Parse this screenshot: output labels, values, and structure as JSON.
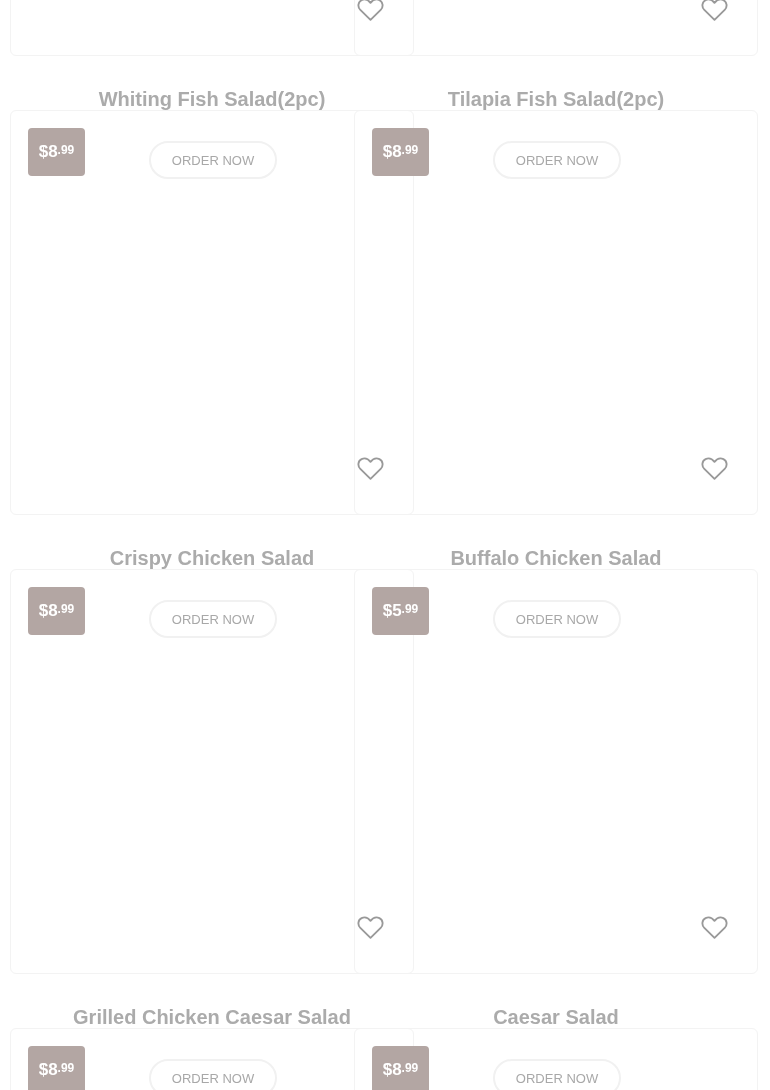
{
  "items": [
    {
      "kind": "card",
      "heart": true
    },
    {
      "kind": "card",
      "heart": true
    },
    {
      "kind": "card",
      "title": "Whiting Fish Salad(2pc)",
      "price_main": "$8",
      "price_cents": ".99",
      "button": "ORDER NOW",
      "heart": true
    },
    {
      "kind": "card",
      "title": "Tilapia Fish Salad(2pc)",
      "price_main": "$8",
      "price_cents": ".99",
      "button": "ORDER NOW",
      "heart": true
    },
    {
      "kind": "card",
      "title": "Crispy Chicken Salad",
      "price_main": "$8",
      "price_cents": ".99",
      "button": "ORDER NOW",
      "heart": true
    },
    {
      "kind": "card",
      "title": "Buffalo Chicken Salad",
      "price_main": "$5",
      "price_cents": ".99",
      "button": "ORDER NOW",
      "heart": true
    },
    {
      "kind": "card",
      "title": "Grilled Chicken Caesar Salad",
      "price_main": "$8",
      "price_cents": ".99",
      "button": "ORDER NOW"
    },
    {
      "kind": "card",
      "title": "Caesar Salad",
      "price_main": "$8",
      "price_cents": ".99",
      "button": "ORDER NOW"
    }
  ]
}
